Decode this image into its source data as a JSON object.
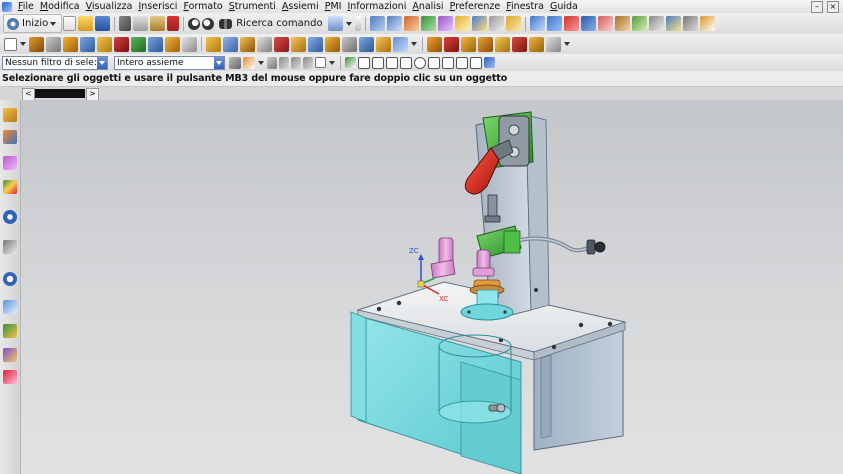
{
  "menu": {
    "items": [
      "File",
      "Modifica",
      "Visualizza",
      "Inserisci",
      "Formato",
      "Strumenti",
      "Assiemi",
      "PMI",
      "Informazioni",
      "Analisi",
      "Preferenze",
      "Finestra",
      "Guida"
    ]
  },
  "toolbar": {
    "start_label": "Inizio",
    "search_label": "Ricerca comando"
  },
  "selection_bar": {
    "filter_value": "Nessun filtro di sele:",
    "scope_value": "Intero assieme"
  },
  "status": {
    "message": "Selezionare gli oggetti e usare il pulsante MB3 del mouse oppure fare doppio clic su un oggetto"
  },
  "viewport": {
    "axis_labels": {
      "zc": "ZC",
      "xc": "XC"
    },
    "colors": {
      "frame": "#b7c3d0",
      "glass": "#6fd3d8",
      "clamp_green": "#3fae3a",
      "handle_red": "#cc1d12",
      "nozzle_pink": "#d98fd0"
    }
  },
  "colors": {
    "accent": "#3462b8",
    "background_top": "#c3c6ca",
    "background_bottom": "#e2e2e3"
  }
}
